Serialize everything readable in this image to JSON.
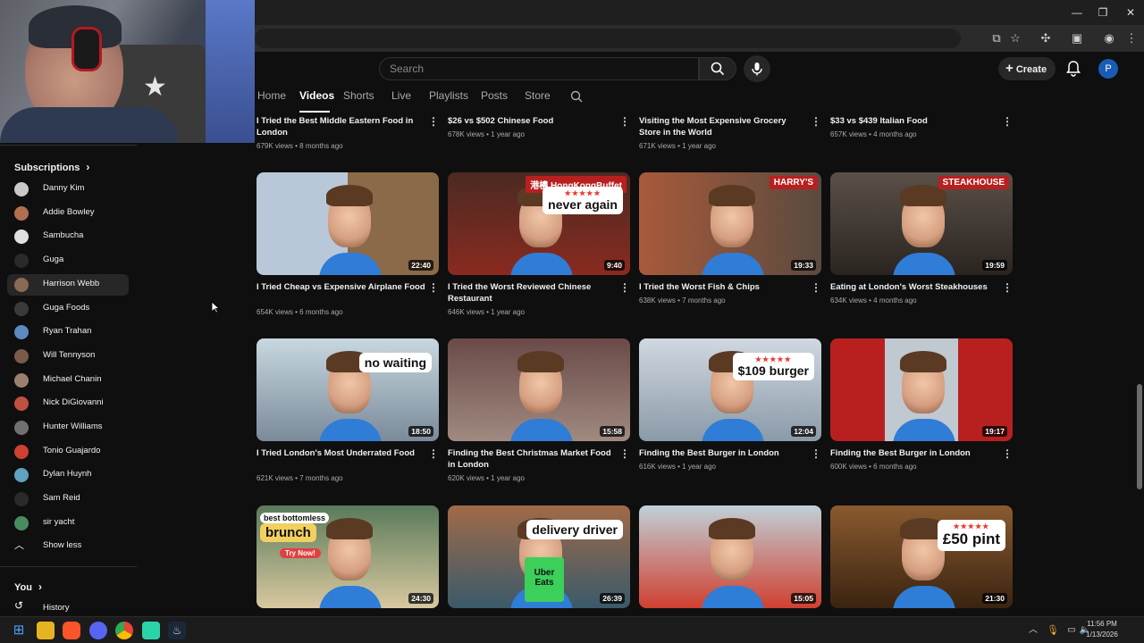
{
  "window": {
    "minimize_glyph": "—",
    "restore_glyph": "❐",
    "close_glyph": "✕"
  },
  "masthead": {
    "search_placeholder": "Search",
    "create_label": "Create",
    "avatar_initial": "P"
  },
  "tabs": [
    "Home",
    "Videos",
    "Shorts",
    "Live",
    "Playlists",
    "Posts",
    "Store"
  ],
  "sidebar": {
    "subscriptions_label": "Subscriptions",
    "channels": [
      {
        "name": "Danny Kim",
        "color": "#c9c9c9"
      },
      {
        "name": "Addie Bowley",
        "color": "#b07050"
      },
      {
        "name": "Sambucha",
        "color": "#e0e0e0"
      },
      {
        "name": "Guga",
        "color": "#2a2a2a"
      },
      {
        "name": "Harrison Webb",
        "color": "#8a6a55"
      },
      {
        "name": "Guga Foods",
        "color": "#3a3a3a"
      },
      {
        "name": "Ryan Trahan",
        "color": "#5a8ac0"
      },
      {
        "name": "Will Tennyson",
        "color": "#7a5a48"
      },
      {
        "name": "Michael Chanin",
        "color": "#9a8070"
      },
      {
        "name": "Nick DiGiovanni",
        "color": "#c05040"
      },
      {
        "name": "Hunter Williams",
        "color": "#707070"
      },
      {
        "name": "Tonio Guajardo",
        "color": "#d04030"
      },
      {
        "name": "Dylan Huynh",
        "color": "#60a0c0"
      },
      {
        "name": "Sam Reid",
        "color": "#2a2a2a"
      },
      {
        "name": "sir yacht",
        "color": "#4a8a60"
      }
    ],
    "show_less_label": "Show less",
    "you_label": "You",
    "history_label": "History"
  },
  "videos": {
    "row0": [
      {
        "title": "I Tried the Best Middle Eastern Food in London",
        "meta": "679K views • 8 months ago"
      },
      {
        "title": "$26 vs $502 Chinese Food",
        "meta": "678K views • 1 year ago"
      },
      {
        "title": "Visiting the Most Expensive Grocery Store in the World",
        "meta": "671K views • 1 year ago"
      },
      {
        "title": "$33 vs $439 Italian Food",
        "meta": "657K views • 4 months ago"
      }
    ],
    "row1": [
      {
        "title": "I Tried Cheap vs Expensive Airplane Food",
        "meta": "654K views • 6 months ago",
        "duration": "22:40"
      },
      {
        "title": "I Tried the Worst Reviewed Chinese Restaurant",
        "meta": "646K views • 1 year ago",
        "duration": "9:40",
        "overlay": "never again",
        "sign": "港樓 HongKongBuffet"
      },
      {
        "title": "I Tried the Worst Fish & Chips",
        "meta": "638K views • 7 months ago",
        "duration": "19:33",
        "sign": "HARRY'S"
      },
      {
        "title": "Eating at London's Worst Steakhouses",
        "meta": "634K views • 4 months ago",
        "duration": "19:59",
        "sign": "STEAKHOUSE"
      }
    ],
    "row2": [
      {
        "title": "I Tried London's Most Underrated Food",
        "meta": "621K views • 7 months ago",
        "duration": "18:50",
        "overlay": "no waiting"
      },
      {
        "title": "Finding the Best Christmas Market Food in London",
        "meta": "620K views • 1 year ago",
        "duration": "15:58"
      },
      {
        "title": "Finding the Best Burger in London",
        "meta": "616K views • 1 year ago",
        "duration": "12:04",
        "overlay": "$109 burger"
      },
      {
        "title": "Finding the Best Burger in London",
        "meta": "600K views • 6 months ago",
        "duration": "19:17"
      }
    ],
    "row3": [
      {
        "duration": "24:30",
        "overlay_top": "best bottomless",
        "overlay": "brunch",
        "overlay_sub": "Try Now!"
      },
      {
        "duration": "26:39",
        "overlay": "delivery driver",
        "bag": "Uber Eats"
      },
      {
        "duration": "15:05"
      },
      {
        "duration": "21:30",
        "overlay": "£50 pint"
      }
    ]
  },
  "stars": "★★★★★",
  "taskbar": {
    "time": "11:56 PM",
    "date": "1/13/2026"
  }
}
